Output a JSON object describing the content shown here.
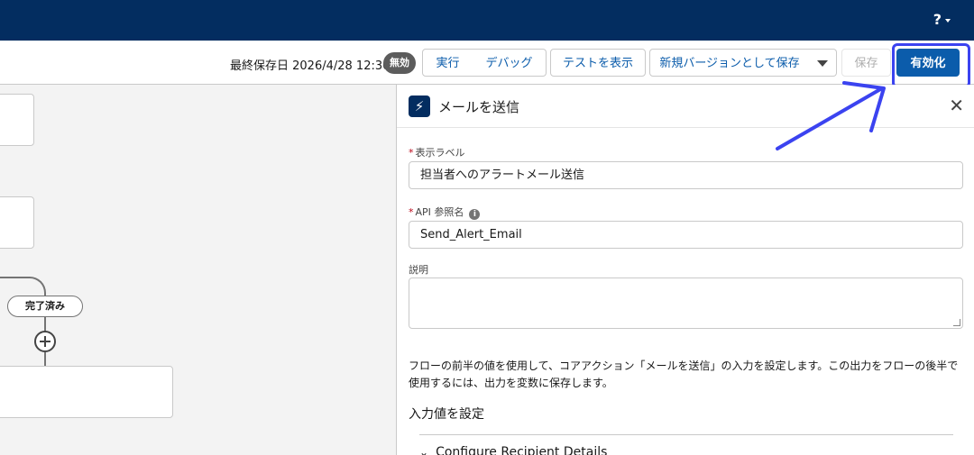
{
  "header": {
    "help_label": "?"
  },
  "toolbar": {
    "last_saved": "最終保存日 2026/4/28 12:30",
    "status_badge": "無効",
    "run_label": "実行",
    "debug_label": "デバッグ",
    "view_tests_label": "テストを表示",
    "save_as_new_version_label": "新規バージョンとして保存",
    "save_label": "保存",
    "activate_label": "有効化"
  },
  "canvas": {
    "completed_label": "完了済み"
  },
  "panel": {
    "icon": "lightning-icon",
    "title": "メールを送信",
    "label_field": {
      "label": "表示ラベル",
      "value": "担当者へのアラートメール送信",
      "required": true
    },
    "api_field": {
      "label": "API 参照名",
      "value": "Send_Alert_Email",
      "required": true
    },
    "description_field": {
      "label": "説明",
      "value": ""
    },
    "help_text": "フローの前半の値を使用して、コアアクション「メールを送信」の入力を設定します。この出力をフローの後半で使用するには、出力を変数に保存します。",
    "section_title": "入力値を設定",
    "accordion_label": "Configure Recipient Details"
  },
  "colors": {
    "brand_navy": "#032d60",
    "brand_blue": "#0b5cab",
    "annotation": "#3b43f0"
  }
}
